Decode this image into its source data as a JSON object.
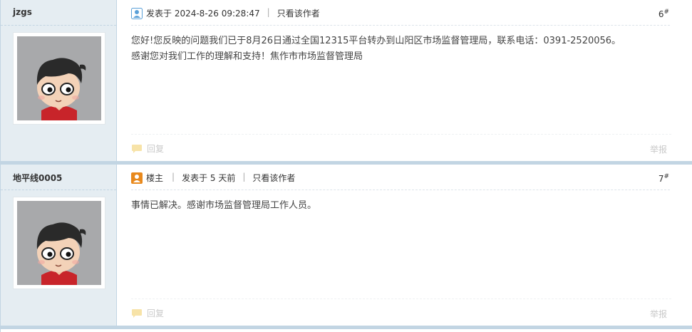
{
  "posts": [
    {
      "author": "jzgs",
      "posted": "发表于 2024-8-26 09:28:47",
      "only_author": "只看该作者",
      "floor_num": "6",
      "floor_mark": "#",
      "lines": [
        "您好!您反映的问题我们已于8月26日通过全国12315平台转办到山阳区市场监督管理局，联系电话：0391-2520056。",
        "感谢您对我们工作的理解和支持！焦作市市场监督管理局"
      ],
      "reply": "回复",
      "report": "举报",
      "icon": "user-icon",
      "icon_color": "#5aa0d8"
    },
    {
      "author": "地平线0005",
      "owner": "楼主",
      "posted": "发表于 5 天前",
      "only_author": "只看该作者",
      "floor_num": "7",
      "floor_mark": "#",
      "lines": [
        "事情已解决。感谢市场监督管理局工作人员。"
      ],
      "reply": "回复",
      "report": "举报",
      "icon": "owner-icon",
      "icon_color": "#e8891d"
    }
  ],
  "colors": {
    "sidebar_bg": "#e5edf2",
    "border": "#c2d5e3"
  }
}
